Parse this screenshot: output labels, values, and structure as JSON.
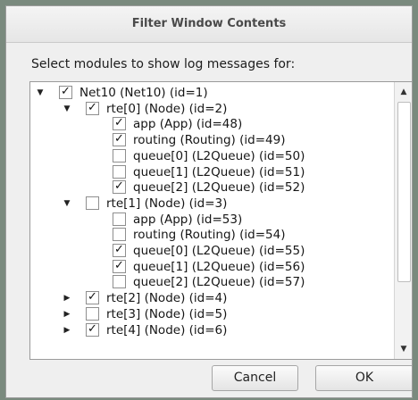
{
  "dialog": {
    "title": "Filter Window Contents",
    "prompt": "Select modules to show log messages for:",
    "cancel_label": "Cancel",
    "ok_label": "OK"
  },
  "tree": [
    {
      "label": "Net10 (Net10) (id=1)",
      "level": 0,
      "expander": "expanded",
      "checked": true
    },
    {
      "label": "rte[0] (Node) (id=2)",
      "level": 1,
      "expander": "expanded",
      "checked": true
    },
    {
      "label": "app (App) (id=48)",
      "level": 2,
      "expander": "none",
      "checked": true
    },
    {
      "label": "routing (Routing) (id=49)",
      "level": 2,
      "expander": "none",
      "checked": true
    },
    {
      "label": "queue[0] (L2Queue) (id=50)",
      "level": 2,
      "expander": "none",
      "checked": false
    },
    {
      "label": "queue[1] (L2Queue) (id=51)",
      "level": 2,
      "expander": "none",
      "checked": false
    },
    {
      "label": "queue[2] (L2Queue) (id=52)",
      "level": 2,
      "expander": "none",
      "checked": true
    },
    {
      "label": "rte[1] (Node) (id=3)",
      "level": 1,
      "expander": "expanded",
      "checked": false
    },
    {
      "label": "app (App) (id=53)",
      "level": 2,
      "expander": "none",
      "checked": false
    },
    {
      "label": "routing (Routing) (id=54)",
      "level": 2,
      "expander": "none",
      "checked": false
    },
    {
      "label": "queue[0] (L2Queue) (id=55)",
      "level": 2,
      "expander": "none",
      "checked": true
    },
    {
      "label": "queue[1] (L2Queue) (id=56)",
      "level": 2,
      "expander": "none",
      "checked": true
    },
    {
      "label": "queue[2] (L2Queue) (id=57)",
      "level": 2,
      "expander": "none",
      "checked": false
    },
    {
      "label": "rte[2] (Node) (id=4)",
      "level": 1,
      "expander": "collapsed",
      "checked": true
    },
    {
      "label": "rte[3] (Node) (id=5)",
      "level": 1,
      "expander": "collapsed",
      "checked": false
    },
    {
      "label": "rte[4] (Node) (id=6)",
      "level": 1,
      "expander": "collapsed",
      "checked": true
    }
  ],
  "icons": {
    "expanded": "triangle-down-icon",
    "collapsed": "triangle-right-icon",
    "check": "checkmark-icon",
    "scroll_up": "scroll-up-arrow-icon",
    "scroll_down": "scroll-down-arrow-icon"
  },
  "colors": {
    "dialog_bg": "#efefef",
    "tree_bg": "#ffffff",
    "border": "#9a9a9a"
  }
}
